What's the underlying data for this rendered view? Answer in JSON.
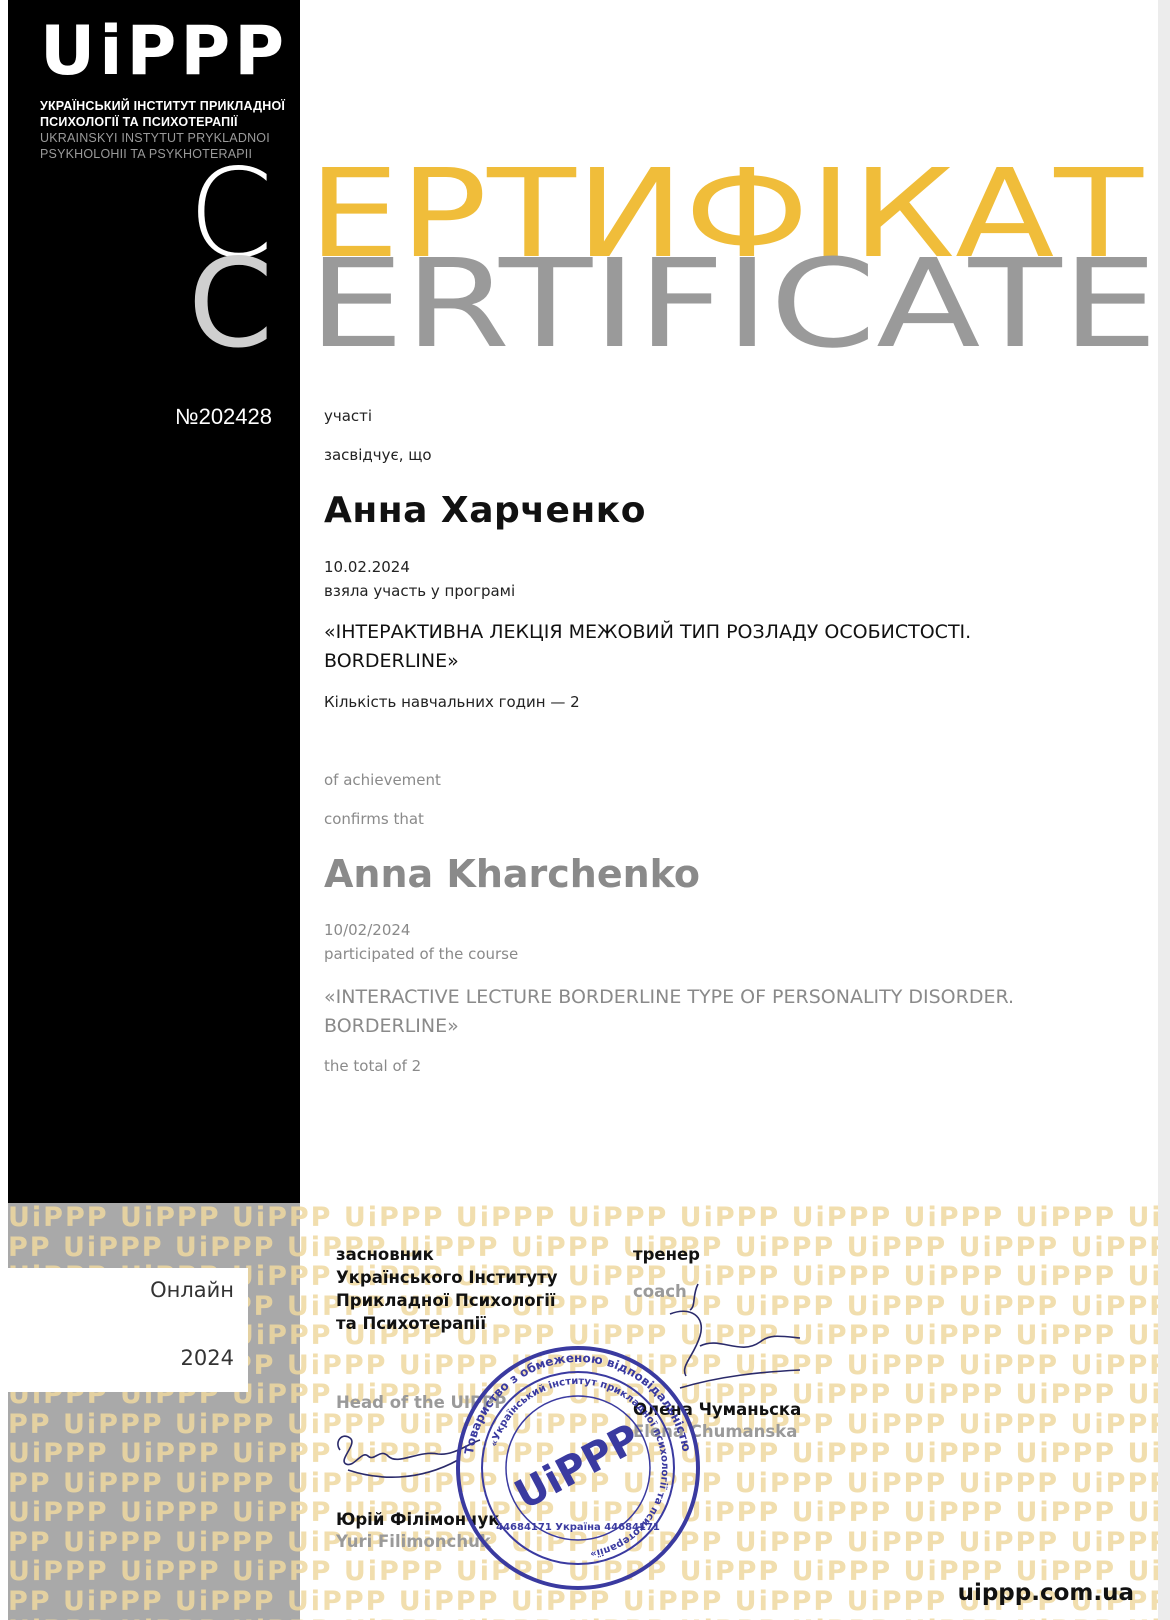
{
  "logo": {
    "mark": "UiPPP",
    "lines_ua": [
      "УКРАЇНСЬКИЙ ІНСТИТУТ ПРИКЛАДНОЇ",
      "ПСИХОЛОГІЇ ТА ПСИХОТЕРАПІЇ"
    ],
    "lines_lat": [
      "UKRAINSKYI INSTYTUT PRYKLADNOI",
      "PSYKHOLOHII TA PSYKHOTERAPII"
    ]
  },
  "title": {
    "ua_first": "С",
    "ua_rest": "ЕРТИФІКАТ",
    "en_first": "C",
    "en_rest": "ERTIFICATE"
  },
  "certificate_number": "№202428",
  "ua": {
    "line1": "участі",
    "line2": "засвідчує, що",
    "name": "Анна Харченко",
    "date": "10.02.2024",
    "took_part": "взяла участь у програмі",
    "course_line1": "«ІНТЕРАКТИВНА ЛЕКЦІЯ МЕЖОВИЙ ТИП РОЗЛАДУ ОСОБИСТОСТІ.",
    "course_line2": "BORDERLINE»",
    "hours": "Кількість навчальних годин — 2"
  },
  "en": {
    "line1": "of achievement",
    "line2": "confirms that",
    "name": "Anna Kharchenko",
    "date": "10/02/2024",
    "took_part": "participated of the course",
    "course_line1": "«INTERACTIVE LECTURE BORDERLINE TYPE OF PERSONALITY DISORDER.",
    "course_line2": "BORDERLINE»",
    "hours": "the total of 2"
  },
  "format_box": {
    "mode": "Онлайн",
    "year": "2024"
  },
  "founder": {
    "role_ua_1": "засновник",
    "role_ua_2": "Українського Інституту",
    "role_ua_3": "Прикладної Психології",
    "role_ua_4": "та Психотерапії",
    "role_en": "Head of the UIPPP",
    "name_ua": "Юрій Філімончук",
    "name_en": "Yuri Filimonchuk"
  },
  "trainer": {
    "role_ua": "тренер",
    "role_en": "coach",
    "name_ua": "Олена Чуманьска",
    "name_en": "Elena Chumanska"
  },
  "stamp": {
    "outer_text": "Товариство з обмеженою відповідальністю",
    "inner_text": "«Український інститут прикладної психології та психотерапії»",
    "center": "UiPPP",
    "code": "44684171 Україна 44684171"
  },
  "pattern_word": "UiPPP",
  "website": "uippp.com.ua",
  "colors": {
    "gold": "#f0bd3a",
    "gray_title": "#9a9a9a",
    "panel": "#000000",
    "pattern": "#efd9a0",
    "stamp": "#3a3aa0"
  }
}
